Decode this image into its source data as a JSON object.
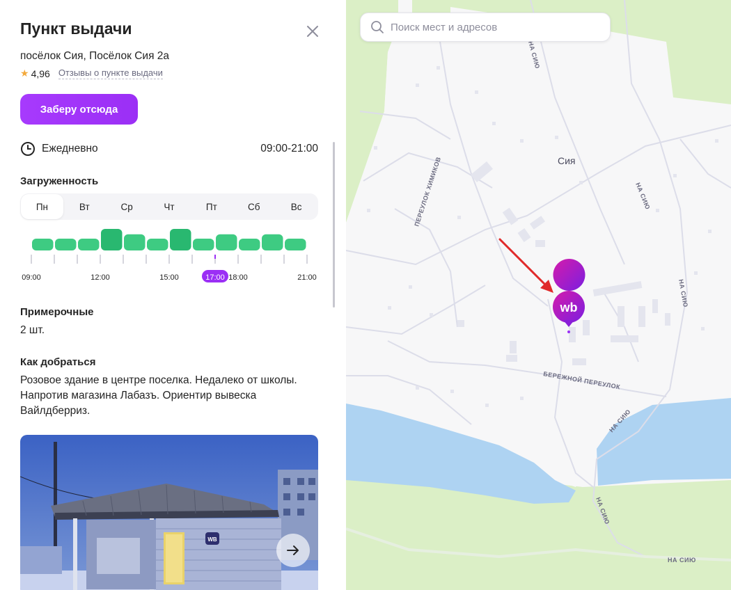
{
  "panel": {
    "title": "Пункт выдачи",
    "address": "посёлок Сия, Посёлок Сия 2а",
    "rating": "4,96",
    "reviews_link": "Отзывы о пункте выдачи",
    "pickup_button": "Заберу отсюда",
    "schedule": {
      "days": "Ежедневно",
      "hours": "09:00-21:00"
    },
    "workload": {
      "title": "Загруженность",
      "tabs": [
        "Пн",
        "Вт",
        "Ср",
        "Чт",
        "Пт",
        "Сб",
        "Вс"
      ],
      "active_tab": 0,
      "hour_labels": [
        "09:00",
        "12:00",
        "15:00",
        "17:00",
        "18:00",
        "21:00"
      ],
      "current_hour": "17:00",
      "bars": [
        {
          "level": 0.55,
          "peak": false
        },
        {
          "level": 0.55,
          "peak": false
        },
        {
          "level": 0.55,
          "peak": false
        },
        {
          "level": 1.0,
          "peak": true
        },
        {
          "level": 0.75,
          "peak": false
        },
        {
          "level": 0.55,
          "peak": false
        },
        {
          "level": 1.0,
          "peak": true
        },
        {
          "level": 0.55,
          "peak": false
        },
        {
          "level": 0.75,
          "peak": false
        },
        {
          "level": 0.55,
          "peak": false
        },
        {
          "level": 0.75,
          "peak": false
        },
        {
          "level": 0.55,
          "peak": false
        }
      ],
      "colors": {
        "bar": "#3ecb82",
        "peak": "#29b870",
        "current": "#9b2ff5"
      }
    },
    "fitting_rooms": {
      "title": "Примерочные",
      "value": "2 шт."
    },
    "directions": {
      "title": "Как добраться",
      "lines": [
        "Розовое здание в центре поселка. Недалеко от школы.",
        "Напротив магазина Лабазъ. Ориентир вывеска",
        "Вайлдберриз."
      ]
    },
    "photo_badge": "WB"
  },
  "map": {
    "search_placeholder": "Поиск мест и адресов",
    "labels": {
      "village": "Сия",
      "street_1": "ПЕРЕУЛОК ХИМИКОВ",
      "street_2": "НА СИЮ",
      "street_3": "НА СИЮ",
      "street_4": "НА СИЮ",
      "street_5": "НА СИЮ",
      "street_6": "НА СИЮ",
      "street_7": "БЕРЕЖНОЙ ПЕРЕУЛОК",
      "street_8": "НА СИЮ"
    },
    "marker_label": "wb",
    "colors": {
      "water": "#aed3f2",
      "forest": "#dbefc6",
      "land": "#f7f7f8",
      "road": "#dcdde9",
      "accent": "#cb11ab",
      "arrow": "#e02a2a"
    }
  }
}
